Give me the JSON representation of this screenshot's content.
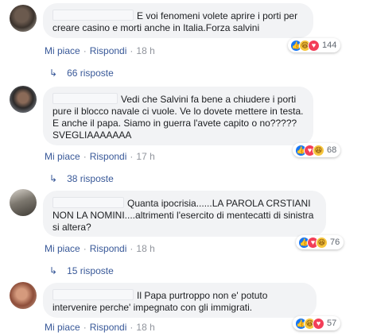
{
  "comments": [
    {
      "text": "E voi fenomeni volete aprire i porti per creare casino e morti anche in Italia.Forza salvini",
      "reaction_count": "144",
      "like_label": "Mi piace",
      "reply_label": "Rispondi",
      "time": "18 h",
      "replies_label": "66 risposte"
    },
    {
      "text": "Vedi che Salvini fa bene a chiudere i porti pure il blocco navale ci vuole. Ve lo dovete mettere in testa. E anche il papa. Siamo in guerra l'avete capito o no????? SVEGLIAAAAAAA",
      "reaction_count": "68",
      "like_label": "Mi piace",
      "reply_label": "Rispondi",
      "time": "17 h",
      "replies_label": "38 risposte"
    },
    {
      "text": "Quanta ipocrisia......LA PAROLA CRSTIANI NON LA NOMINI....altrimenti l'esercito di mentecatti di sinistra si altera?",
      "reaction_count": "76",
      "like_label": "Mi piace",
      "reply_label": "Rispondi",
      "time": "18 h",
      "replies_label": "15 risposte"
    },
    {
      "text": "Il Papa purtroppo non e' potuto intervenire perche' impegnato con gli immigrati.",
      "reaction_count": "57",
      "like_label": "Mi piace",
      "reply_label": "Rispondi",
      "time": "18 h"
    }
  ],
  "reaction_icons": [
    "like-icon",
    "haha-icon",
    "love-icon"
  ],
  "colors": {
    "link": "#385898",
    "bubble": "#f2f3f5",
    "like": "#1877f2",
    "haha": "#f7c63d",
    "love": "#f33e58"
  }
}
